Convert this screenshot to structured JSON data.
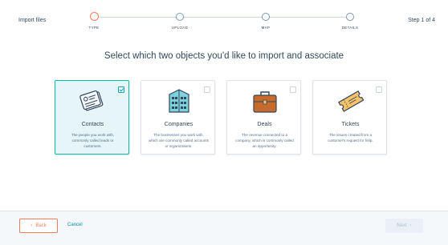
{
  "header": {
    "title": "Import files",
    "step_counter": "Step 1 of 4",
    "steps": [
      {
        "label": "TYPE",
        "status": "active"
      },
      {
        "label": "UPLOAD",
        "status": "pending"
      },
      {
        "label": "MAP",
        "status": "pending"
      },
      {
        "label": "DETAILS",
        "status": "pending"
      }
    ]
  },
  "main": {
    "heading": "Select which two objects you'd like to import and associate",
    "objects": [
      {
        "title": "Contacts",
        "description": "The people you work with, commonly called leads or customers.",
        "selected": true,
        "icon": "contacts-icon"
      },
      {
        "title": "Companies",
        "description": "The businesses you work with, which are commonly called accounts or organizations.",
        "selected": false,
        "icon": "building-icon"
      },
      {
        "title": "Deals",
        "description": "The revenue connected to a company, which is commonly called an opportunity.",
        "selected": false,
        "icon": "briefcase-icon"
      },
      {
        "title": "Tickets",
        "description": "The issues created from a customer's request for help.",
        "selected": false,
        "icon": "ticket-icon"
      }
    ]
  },
  "footer": {
    "back_label": "Back",
    "cancel_label": "Cancel",
    "next_label": "Next"
  },
  "colors": {
    "accent": "#ff7a59",
    "selected_border": "#00bda5",
    "link": "#0091ae",
    "text": "#33475b"
  }
}
